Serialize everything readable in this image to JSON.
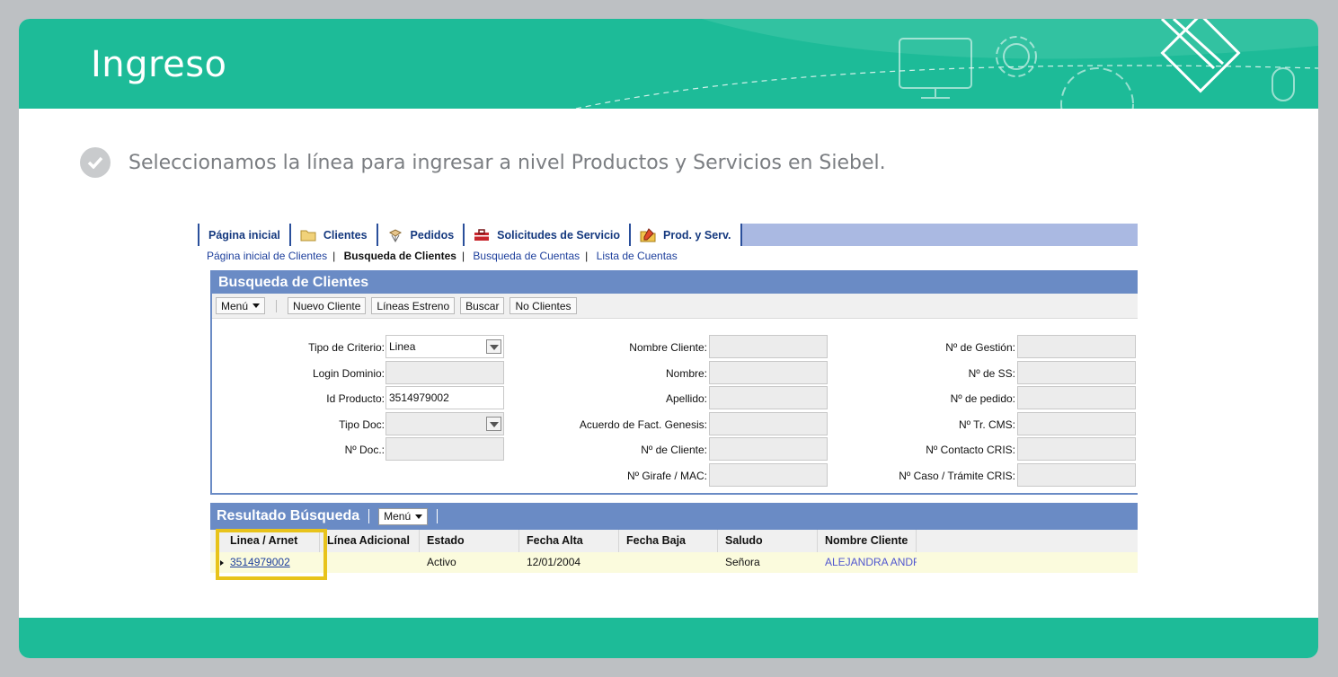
{
  "slide": {
    "title": "Ingreso",
    "bullet_text": "Seleccionamos la línea para ingresar a nivel Productos y Servicios en Siebel.",
    "colors": {
      "header": "#1dbb98",
      "highlight": "#e8c31b"
    }
  },
  "siebel": {
    "tabs": [
      {
        "label": "Página inicial",
        "icon": ""
      },
      {
        "label": "Clientes",
        "icon": "folder-icon"
      },
      {
        "label": "Pedidos",
        "icon": "package-icon"
      },
      {
        "label": "Solicitudes de Servicio",
        "icon": "toolbox-icon"
      },
      {
        "label": "Prod. y Serv.",
        "icon": "edit-folder-icon"
      }
    ],
    "subnav": {
      "item1": "Página inicial de Clientes",
      "item2": "Busqueda de Clientes",
      "item3": "Busqueda de Cuentas",
      "item4": "Lista de Cuentas"
    },
    "search_panel": {
      "title": "Busqueda de Clientes",
      "menu_label": "Menú",
      "btn_nuevo": "Nuevo Cliente",
      "btn_lineas": "Líneas Estreno",
      "btn_buscar": "Buscar",
      "btn_noclientes": "No Clientes"
    },
    "form": {
      "tipo_criterio_label": "Tipo de Criterio:",
      "tipo_criterio_value": "Linea",
      "login_label": "Login Dominio:",
      "id_producto_label": "Id Producto:",
      "id_producto_value": "3514979002",
      "tipo_doc_label": "Tipo Doc:",
      "nro_doc_label": "Nº Doc.:",
      "nombre_cliente_label": "Nombre Cliente:",
      "nombre_label": "Nombre:",
      "apellido_label": "Apellido:",
      "acuerdo_label": "Acuerdo de Fact. Genesis:",
      "nro_cliente_label": "Nº de Cliente:",
      "girafe_label": "Nº Girafe / MAC:",
      "gestion_label": "Nº de Gestión:",
      "ss_label": "Nº de SS:",
      "pedido_label": "Nº de pedido:",
      "cms_label": "Nº Tr. CMS:",
      "contacto_label": "Nº Contacto CRIS:",
      "caso_label": "Nº Caso / Trámite CRIS:"
    },
    "results": {
      "title": "Resultado Búsqueda",
      "menu_label": "Menú",
      "columns": {
        "c1": "Linea / Arnet",
        "c2": "Línea Adicional",
        "c3": "Estado",
        "c4": "Fecha Alta",
        "c5": "Fecha Baja",
        "c6": "Saludo",
        "c7": "Nombre Cliente"
      },
      "row": {
        "linea": "3514979002",
        "adicional": "",
        "estado": "Activo",
        "fecha_alta": "12/01/2004",
        "fecha_baja": "",
        "saludo": "Señora",
        "nombre": "ALEJANDRA ANDRE..."
      }
    }
  }
}
